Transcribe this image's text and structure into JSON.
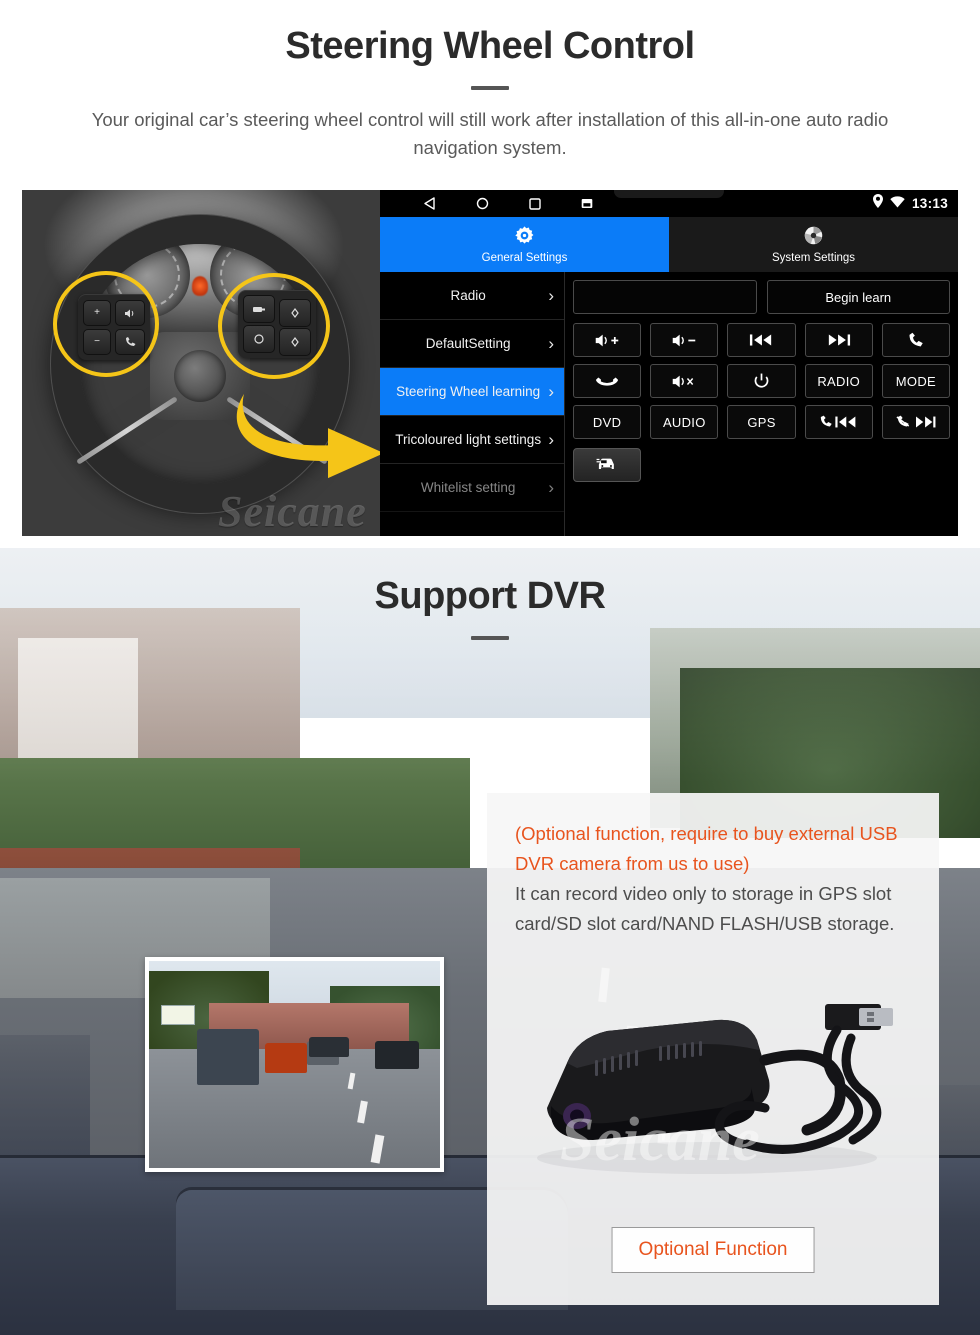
{
  "section1": {
    "title": "Steering Wheel Control",
    "subtitle": "Your original car’s steering wheel control will still work after installation of this all-in-one auto radio navigation system."
  },
  "head_unit": {
    "statusbar": {
      "nav_back_icon": "back-triangle-icon",
      "nav_home_icon": "home-circle-icon",
      "nav_recents_icon": "recents-square-icon",
      "nav_screenshot_icon": "screenshot-icon",
      "location_icon": "location-pin-icon",
      "wifi_icon": "wifi-icon",
      "clock": "13:13"
    },
    "tabs": [
      {
        "label": "General Settings",
        "icon": "gear-icon",
        "active": true
      },
      {
        "label": "System Settings",
        "icon": "system-gear-icon",
        "active": false
      }
    ],
    "menu": [
      {
        "label": "Radio",
        "selected": false
      },
      {
        "label": "DefaultSetting",
        "selected": false
      },
      {
        "label": "Steering Wheel learning",
        "selected": true
      },
      {
        "label": "Tricoloured light settings",
        "selected": false
      },
      {
        "label": "Whitelist setting",
        "selected": false
      }
    ],
    "chevron": "›",
    "input_value": "",
    "begin_learn_label": "Begin learn",
    "buttons": [
      {
        "label": "",
        "icon": "volume-up-icon"
      },
      {
        "label": "",
        "icon": "volume-down-icon"
      },
      {
        "label": "",
        "icon": "previous-track-icon"
      },
      {
        "label": "",
        "icon": "next-track-icon"
      },
      {
        "label": "",
        "icon": "phone-answer-icon"
      },
      {
        "label": "",
        "icon": "phone-hangup-icon"
      },
      {
        "label": "",
        "icon": "mute-icon"
      },
      {
        "label": "",
        "icon": "power-icon"
      },
      {
        "label": "RADIO",
        "icon": ""
      },
      {
        "label": "MODE",
        "icon": ""
      },
      {
        "label": "DVD",
        "icon": ""
      },
      {
        "label": "AUDIO",
        "icon": ""
      },
      {
        "label": "GPS",
        "icon": ""
      },
      {
        "label": "",
        "icon": "phone-previous-icon"
      },
      {
        "label": "",
        "icon": "phone-reject-next-icon"
      }
    ],
    "car_button_icon": "car-icon",
    "accent_color": "#0b7cf8"
  },
  "photo": {
    "watermark": "Seicane",
    "highlight_color": "#f5c518",
    "arrow_icon": "curved-arrow-icon"
  },
  "section2": {
    "title": "Support DVR",
    "watermark": "Seicane",
    "card": {
      "orange_text": "(Optional function, require to buy external USB DVR camera from us to use)",
      "grey_text": "It can record video only to storage in GPS slot card/SD slot card/NAND FLASH/USB storage.",
      "orange_color": "#e8541e",
      "button_label": "Optional Function",
      "device_icon": "usb-dashcam-icon"
    },
    "inset_label": "dvr-recording-preview"
  }
}
